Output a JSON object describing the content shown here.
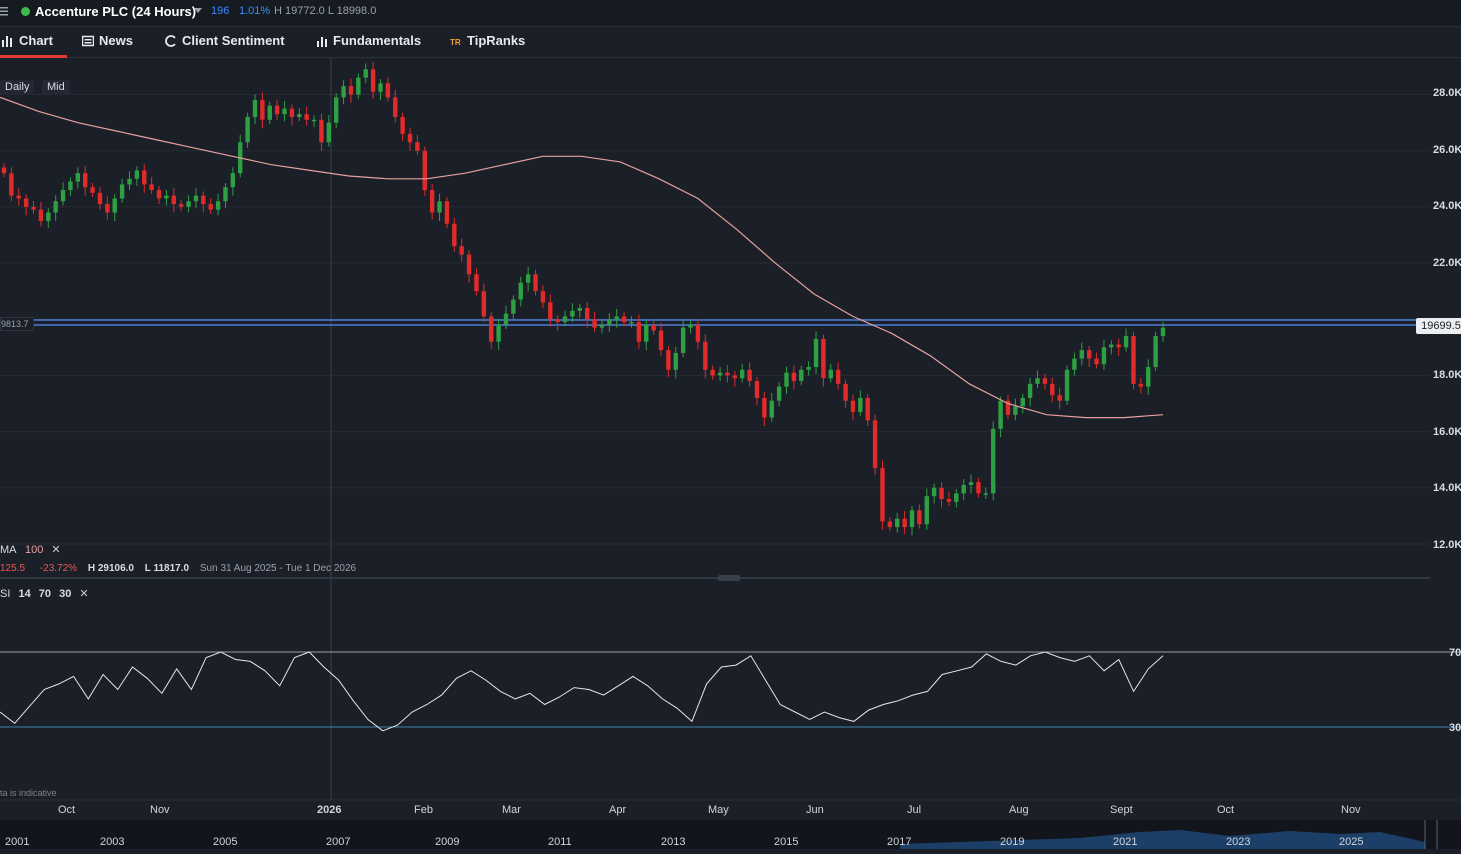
{
  "header": {
    "instrument": "Accenture PLC (24 Hours)",
    "change": "196",
    "change_pct": "1.01%",
    "high_low": "H 19772.0  L 18998.0"
  },
  "tabs": [
    {
      "label": "Chart",
      "icon": "chart-icon"
    },
    {
      "label": "News",
      "icon": "news-icon"
    },
    {
      "label": "Client Sentiment",
      "icon": "sentiment-icon"
    },
    {
      "label": "Fundamentals",
      "icon": "bar-chart-icon"
    },
    {
      "label": "TipRanks",
      "icon": "tipranks-icon"
    }
  ],
  "controls": {
    "interval": "Daily",
    "price_type": "Mid"
  },
  "ma_legend": {
    "name": "MA",
    "period": "100",
    "value": "125.5",
    "pct": "-23.72%",
    "high": "H 29106.0",
    "low": "L 11817.0",
    "range": "Sun 31 Aug 2025 - Tue 1 Dec 2026"
  },
  "rsi_legend": {
    "name": "SI",
    "p1": "14",
    "p2": "70",
    "p3": "30"
  },
  "price_line_left": "9813.7",
  "price_tag": "19699.5",
  "disclaimer": "ta is indicative",
  "colors": {
    "up": "#2ea043",
    "down": "#e02b2b",
    "ma": "#e8a0a0",
    "rsi": "#e6e6e6",
    "hline": "#4d7fd6"
  },
  "chart_data": {
    "type": "candlestick",
    "y_ticks": [
      "28.0K",
      "26.0K",
      "24.0K",
      "22.0K",
      "18.0K",
      "16.0K",
      "14.0K",
      "12.0K"
    ],
    "ylim": [
      11500,
      29300
    ],
    "months": [
      "Oct",
      "Nov",
      "2026",
      "Feb",
      "Mar",
      "Apr",
      "May",
      "Jun",
      "Jul",
      "Aug",
      "Sept",
      "Oct",
      "Nov"
    ],
    "closes": [
      25200,
      24400,
      24300,
      24000,
      23900,
      23500,
      23800,
      24200,
      24600,
      24900,
      25200,
      24700,
      24500,
      24100,
      23800,
      24300,
      24800,
      25000,
      25300,
      24800,
      24600,
      24300,
      24400,
      24100,
      24000,
      24200,
      24400,
      24100,
      23900,
      24200,
      24700,
      25200,
      26300,
      27200,
      27800,
      27100,
      27600,
      27300,
      27500,
      27200,
      27300,
      27100,
      27100,
      26300,
      27000,
      27900,
      28300,
      28000,
      28600,
      28900,
      28100,
      28400,
      27900,
      27200,
      26600,
      26300,
      26000,
      24600,
      23800,
      24200,
      23400,
      22600,
      22300,
      21600,
      21000,
      20100,
      19200,
      19800,
      20200,
      20700,
      21300,
      21600,
      21000,
      20600,
      20000,
      19900,
      20100,
      20300,
      20400,
      20000,
      19700,
      19800,
      20000,
      20100,
      19900,
      19900,
      19200,
      19800,
      19600,
      18900,
      18200,
      18800,
      19700,
      19800,
      19200,
      18200,
      18000,
      18100,
      18000,
      17900,
      18200,
      17800,
      17200,
      16500,
      17100,
      17600,
      18100,
      17800,
      18200,
      18300,
      19300,
      17900,
      18200,
      17700,
      17100,
      16700,
      17200,
      16400,
      14700,
      12800,
      12600,
      12900,
      12600,
      13200,
      12700,
      13700,
      14000,
      13600,
      13500,
      13800,
      14100,
      14200,
      13800,
      13800,
      16100,
      17100,
      16600,
      16900,
      17200,
      17700,
      17900,
      17700,
      17300,
      17100,
      18200,
      18600,
      18900,
      18600,
      18400,
      19000,
      19100,
      19000,
      19400,
      17700,
      17600,
      18300,
      19400,
      19700
    ],
    "ma100": [
      27900,
      27400,
      27000,
      26700,
      26400,
      26100,
      25800,
      25500,
      25300,
      25100,
      25000,
      25000,
      25200,
      25500,
      25800,
      25800,
      25600,
      25000,
      24300,
      23200,
      22000,
      20900,
      20100,
      19500,
      18700,
      17700,
      17000,
      16600,
      16500,
      16500,
      16600
    ],
    "rsi": [
      38,
      32,
      41,
      50,
      53,
      57,
      45,
      58,
      50,
      62,
      56,
      48,
      61,
      50,
      67,
      70,
      66,
      65,
      60,
      52,
      67,
      70,
      62,
      55,
      44,
      34,
      28,
      31,
      38,
      42,
      47,
      56,
      60,
      55,
      49,
      45,
      48,
      42,
      46,
      51,
      50,
      47,
      52,
      57,
      52,
      45,
      40,
      33,
      53,
      62,
      63,
      68,
      55,
      42,
      38,
      34,
      38,
      35,
      33,
      39,
      42,
      44,
      47,
      49,
      58,
      60,
      62,
      69,
      65,
      63,
      68,
      70,
      67,
      65,
      68,
      60,
      66,
      49,
      61,
      68
    ]
  }
}
